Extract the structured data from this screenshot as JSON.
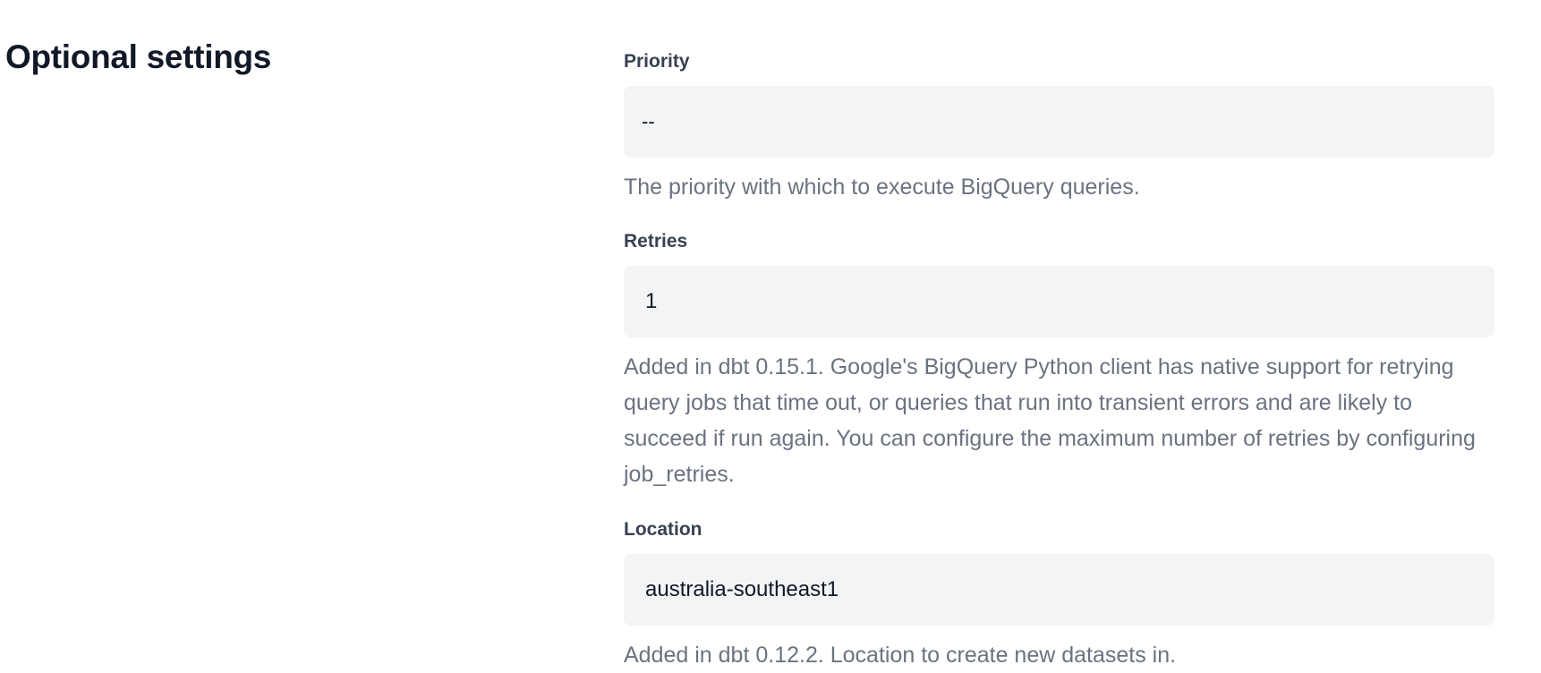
{
  "section": {
    "title": "Optional settings"
  },
  "fields": {
    "priority": {
      "label": "Priority",
      "value": "--",
      "help": "The priority with which to execute BigQuery queries."
    },
    "retries": {
      "label": "Retries",
      "value": "1",
      "help": "Added in dbt 0.15.1. Google's BigQuery Python client has native support for retrying query jobs that time out, or queries that run into transient errors and are likely to succeed if run again. You can configure the maximum number of retries by configuring job_retries."
    },
    "location": {
      "label": "Location",
      "value": "australia-southeast1",
      "help": "Added in dbt 0.12.2. Location to create new datasets in."
    }
  },
  "colors": {
    "title": "#111827",
    "label": "#374151",
    "help_text": "#6b7280",
    "input_background": "#f3f4f6"
  }
}
